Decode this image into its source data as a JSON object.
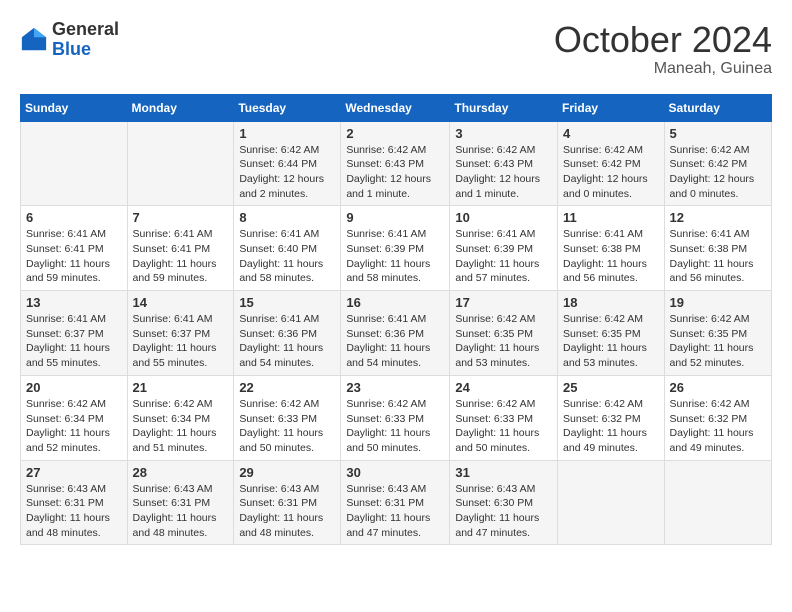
{
  "logo": {
    "general": "General",
    "blue": "Blue"
  },
  "header": {
    "month": "October 2024",
    "location": "Maneah, Guinea"
  },
  "weekdays": [
    "Sunday",
    "Monday",
    "Tuesday",
    "Wednesday",
    "Thursday",
    "Friday",
    "Saturday"
  ],
  "weeks": [
    [
      {
        "day": "",
        "sunrise": "",
        "sunset": "",
        "daylight": ""
      },
      {
        "day": "",
        "sunrise": "",
        "sunset": "",
        "daylight": ""
      },
      {
        "day": "1",
        "sunrise": "Sunrise: 6:42 AM",
        "sunset": "Sunset: 6:44 PM",
        "daylight": "Daylight: 12 hours and 2 minutes."
      },
      {
        "day": "2",
        "sunrise": "Sunrise: 6:42 AM",
        "sunset": "Sunset: 6:43 PM",
        "daylight": "Daylight: 12 hours and 1 minute."
      },
      {
        "day": "3",
        "sunrise": "Sunrise: 6:42 AM",
        "sunset": "Sunset: 6:43 PM",
        "daylight": "Daylight: 12 hours and 1 minute."
      },
      {
        "day": "4",
        "sunrise": "Sunrise: 6:42 AM",
        "sunset": "Sunset: 6:42 PM",
        "daylight": "Daylight: 12 hours and 0 minutes."
      },
      {
        "day": "5",
        "sunrise": "Sunrise: 6:42 AM",
        "sunset": "Sunset: 6:42 PM",
        "daylight": "Daylight: 12 hours and 0 minutes."
      }
    ],
    [
      {
        "day": "6",
        "sunrise": "Sunrise: 6:41 AM",
        "sunset": "Sunset: 6:41 PM",
        "daylight": "Daylight: 11 hours and 59 minutes."
      },
      {
        "day": "7",
        "sunrise": "Sunrise: 6:41 AM",
        "sunset": "Sunset: 6:41 PM",
        "daylight": "Daylight: 11 hours and 59 minutes."
      },
      {
        "day": "8",
        "sunrise": "Sunrise: 6:41 AM",
        "sunset": "Sunset: 6:40 PM",
        "daylight": "Daylight: 11 hours and 58 minutes."
      },
      {
        "day": "9",
        "sunrise": "Sunrise: 6:41 AM",
        "sunset": "Sunset: 6:39 PM",
        "daylight": "Daylight: 11 hours and 58 minutes."
      },
      {
        "day": "10",
        "sunrise": "Sunrise: 6:41 AM",
        "sunset": "Sunset: 6:39 PM",
        "daylight": "Daylight: 11 hours and 57 minutes."
      },
      {
        "day": "11",
        "sunrise": "Sunrise: 6:41 AM",
        "sunset": "Sunset: 6:38 PM",
        "daylight": "Daylight: 11 hours and 56 minutes."
      },
      {
        "day": "12",
        "sunrise": "Sunrise: 6:41 AM",
        "sunset": "Sunset: 6:38 PM",
        "daylight": "Daylight: 11 hours and 56 minutes."
      }
    ],
    [
      {
        "day": "13",
        "sunrise": "Sunrise: 6:41 AM",
        "sunset": "Sunset: 6:37 PM",
        "daylight": "Daylight: 11 hours and 55 minutes."
      },
      {
        "day": "14",
        "sunrise": "Sunrise: 6:41 AM",
        "sunset": "Sunset: 6:37 PM",
        "daylight": "Daylight: 11 hours and 55 minutes."
      },
      {
        "day": "15",
        "sunrise": "Sunrise: 6:41 AM",
        "sunset": "Sunset: 6:36 PM",
        "daylight": "Daylight: 11 hours and 54 minutes."
      },
      {
        "day": "16",
        "sunrise": "Sunrise: 6:41 AM",
        "sunset": "Sunset: 6:36 PM",
        "daylight": "Daylight: 11 hours and 54 minutes."
      },
      {
        "day": "17",
        "sunrise": "Sunrise: 6:42 AM",
        "sunset": "Sunset: 6:35 PM",
        "daylight": "Daylight: 11 hours and 53 minutes."
      },
      {
        "day": "18",
        "sunrise": "Sunrise: 6:42 AM",
        "sunset": "Sunset: 6:35 PM",
        "daylight": "Daylight: 11 hours and 53 minutes."
      },
      {
        "day": "19",
        "sunrise": "Sunrise: 6:42 AM",
        "sunset": "Sunset: 6:35 PM",
        "daylight": "Daylight: 11 hours and 52 minutes."
      }
    ],
    [
      {
        "day": "20",
        "sunrise": "Sunrise: 6:42 AM",
        "sunset": "Sunset: 6:34 PM",
        "daylight": "Daylight: 11 hours and 52 minutes."
      },
      {
        "day": "21",
        "sunrise": "Sunrise: 6:42 AM",
        "sunset": "Sunset: 6:34 PM",
        "daylight": "Daylight: 11 hours and 51 minutes."
      },
      {
        "day": "22",
        "sunrise": "Sunrise: 6:42 AM",
        "sunset": "Sunset: 6:33 PM",
        "daylight": "Daylight: 11 hours and 50 minutes."
      },
      {
        "day": "23",
        "sunrise": "Sunrise: 6:42 AM",
        "sunset": "Sunset: 6:33 PM",
        "daylight": "Daylight: 11 hours and 50 minutes."
      },
      {
        "day": "24",
        "sunrise": "Sunrise: 6:42 AM",
        "sunset": "Sunset: 6:33 PM",
        "daylight": "Daylight: 11 hours and 50 minutes."
      },
      {
        "day": "25",
        "sunrise": "Sunrise: 6:42 AM",
        "sunset": "Sunset: 6:32 PM",
        "daylight": "Daylight: 11 hours and 49 minutes."
      },
      {
        "day": "26",
        "sunrise": "Sunrise: 6:42 AM",
        "sunset": "Sunset: 6:32 PM",
        "daylight": "Daylight: 11 hours and 49 minutes."
      }
    ],
    [
      {
        "day": "27",
        "sunrise": "Sunrise: 6:43 AM",
        "sunset": "Sunset: 6:31 PM",
        "daylight": "Daylight: 11 hours and 48 minutes."
      },
      {
        "day": "28",
        "sunrise": "Sunrise: 6:43 AM",
        "sunset": "Sunset: 6:31 PM",
        "daylight": "Daylight: 11 hours and 48 minutes."
      },
      {
        "day": "29",
        "sunrise": "Sunrise: 6:43 AM",
        "sunset": "Sunset: 6:31 PM",
        "daylight": "Daylight: 11 hours and 48 minutes."
      },
      {
        "day": "30",
        "sunrise": "Sunrise: 6:43 AM",
        "sunset": "Sunset: 6:31 PM",
        "daylight": "Daylight: 11 hours and 47 minutes."
      },
      {
        "day": "31",
        "sunrise": "Sunrise: 6:43 AM",
        "sunset": "Sunset: 6:30 PM",
        "daylight": "Daylight: 11 hours and 47 minutes."
      },
      {
        "day": "",
        "sunrise": "",
        "sunset": "",
        "daylight": ""
      },
      {
        "day": "",
        "sunrise": "",
        "sunset": "",
        "daylight": ""
      }
    ]
  ]
}
